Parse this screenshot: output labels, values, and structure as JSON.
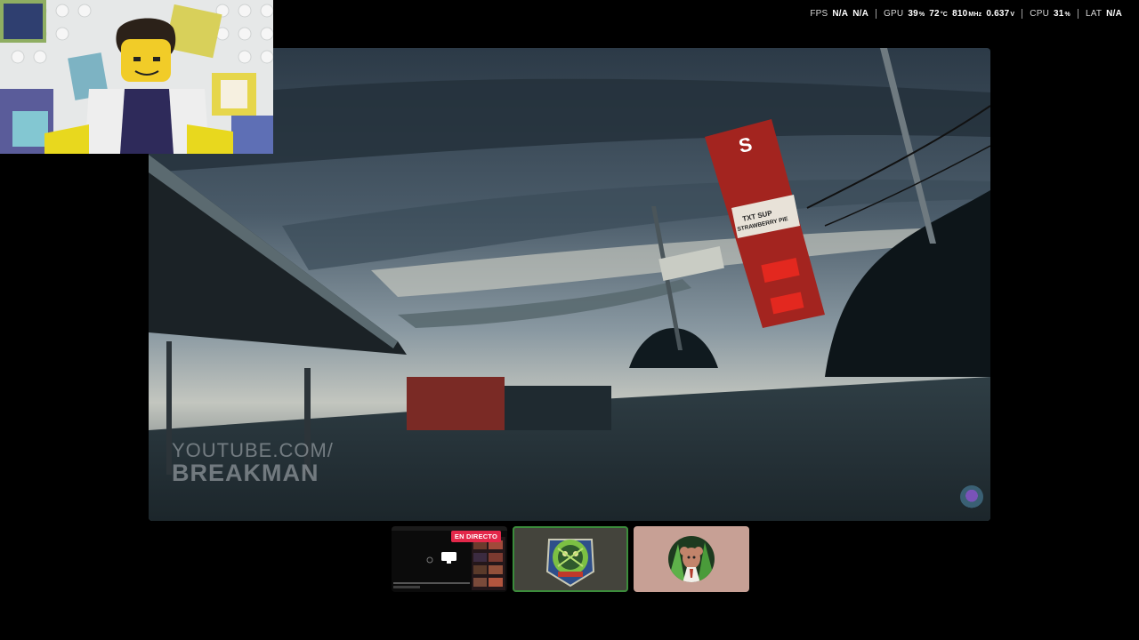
{
  "perf_overlay": {
    "fps": {
      "label": "FPS",
      "values": [
        "N/A",
        "N/A"
      ]
    },
    "gpu": {
      "label": "GPU",
      "usage": "39",
      "usage_unit": "%",
      "temp": "72",
      "temp_unit": "°C",
      "clock": "810",
      "clock_unit": "MHz",
      "voltage": "0.637",
      "voltage_unit": "V"
    },
    "cpu": {
      "label": "CPU",
      "usage": "31",
      "usage_unit": "%"
    },
    "lat": {
      "label": "LAT",
      "value": "N/A"
    }
  },
  "main_stream": {
    "watermark_line1": "YOUTUBE.COM/",
    "watermark_line2": "BREAKMAN",
    "sign_text_top": "TXT SUP",
    "sign_text_bottom": "STRAWBERRY PIE"
  },
  "thumbnails": [
    {
      "kind": "screen-share",
      "badge": "EN DIRECTO",
      "active": false
    },
    {
      "kind": "user-avatar",
      "active": true
    },
    {
      "kind": "user-avatar",
      "active": false
    }
  ],
  "colors": {
    "live_badge": "#e3284a",
    "active_outline": "#3b8c3b",
    "thumb2_bg": "#44443c",
    "thumb3_bg": "#c7a095"
  }
}
